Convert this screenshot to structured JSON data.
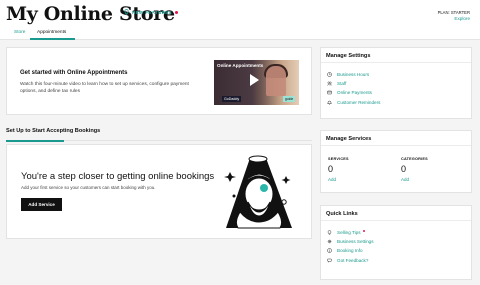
{
  "header": {
    "title": "My Online Store",
    "new_features": "NEW FEATURES",
    "plan_label": "PLAN: STARTER",
    "explore_label": "Explore"
  },
  "tabs": [
    {
      "label": "Store",
      "active": false
    },
    {
      "label": "Appointments",
      "active": true
    }
  ],
  "get_started": {
    "title": "Get started with Online Appointments",
    "description": "Watch this four-minute video to learn how to set up services, configure payment options, and define tax rules",
    "video_caption": "Online Appointments",
    "video_brand": "GoDaddy",
    "video_tag": "guide"
  },
  "setup": {
    "heading": "Set Up to Start Accepting Bookings",
    "title": "You're a step closer to getting online bookings",
    "description": "Add your first service so your customers can start booking with you.",
    "button_label": "Add Service"
  },
  "manage_settings": {
    "title": "Manage Settings",
    "items": [
      {
        "label": "Business Hours",
        "icon": "clock-icon"
      },
      {
        "label": "Staff",
        "icon": "people-icon"
      },
      {
        "label": "Online Payments",
        "icon": "credit-card-icon"
      },
      {
        "label": "Customer Reminders",
        "icon": "bell-icon"
      }
    ]
  },
  "manage_services": {
    "title": "Manage Services",
    "services_label": "SERVICES",
    "services_count": "0",
    "services_add": "Add",
    "categories_label": "CATEGORIES",
    "categories_count": "0",
    "categories_add": "Add"
  },
  "quick_links": {
    "title": "Quick Links",
    "items": [
      {
        "label": "Selling Tips",
        "icon": "lightbulb-icon",
        "badge": true
      },
      {
        "label": "Business Settings",
        "icon": "gear-icon"
      },
      {
        "label": "Booking Info",
        "icon": "info-icon"
      },
      {
        "label": "Got Feedback?",
        "icon": "chat-icon"
      }
    ]
  },
  "colors": {
    "accent": "#1a9a8e",
    "badge": "#e4154b",
    "button": "#111111"
  }
}
